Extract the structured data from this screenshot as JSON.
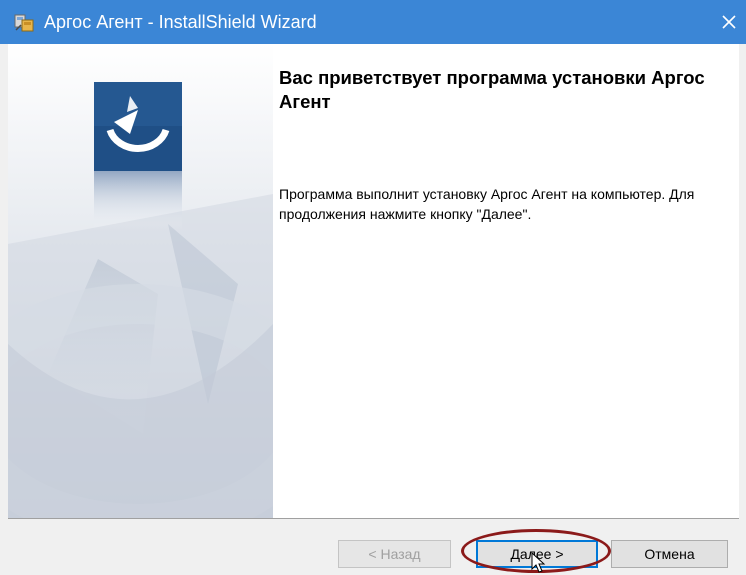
{
  "window": {
    "title": "Аргос Агент - InstallShield Wizard",
    "titlebar_color": "#3b86d6"
  },
  "icons": {
    "app": "installer-icon",
    "close": "close-icon",
    "logo": "argos-logo-icon"
  },
  "main": {
    "heading": "Вас приветствует программа установки Аргос Агент",
    "description": "Программа выполнит установку Аргос Агент на компьютер. Для продолжения нажмите кнопку \"Далее\"."
  },
  "buttons": {
    "back_label": "< Назад",
    "back_enabled": false,
    "next_label": "Далее >",
    "cancel_label": "Отмена"
  },
  "annotation": {
    "highlight_color": "#8b1a1a"
  }
}
